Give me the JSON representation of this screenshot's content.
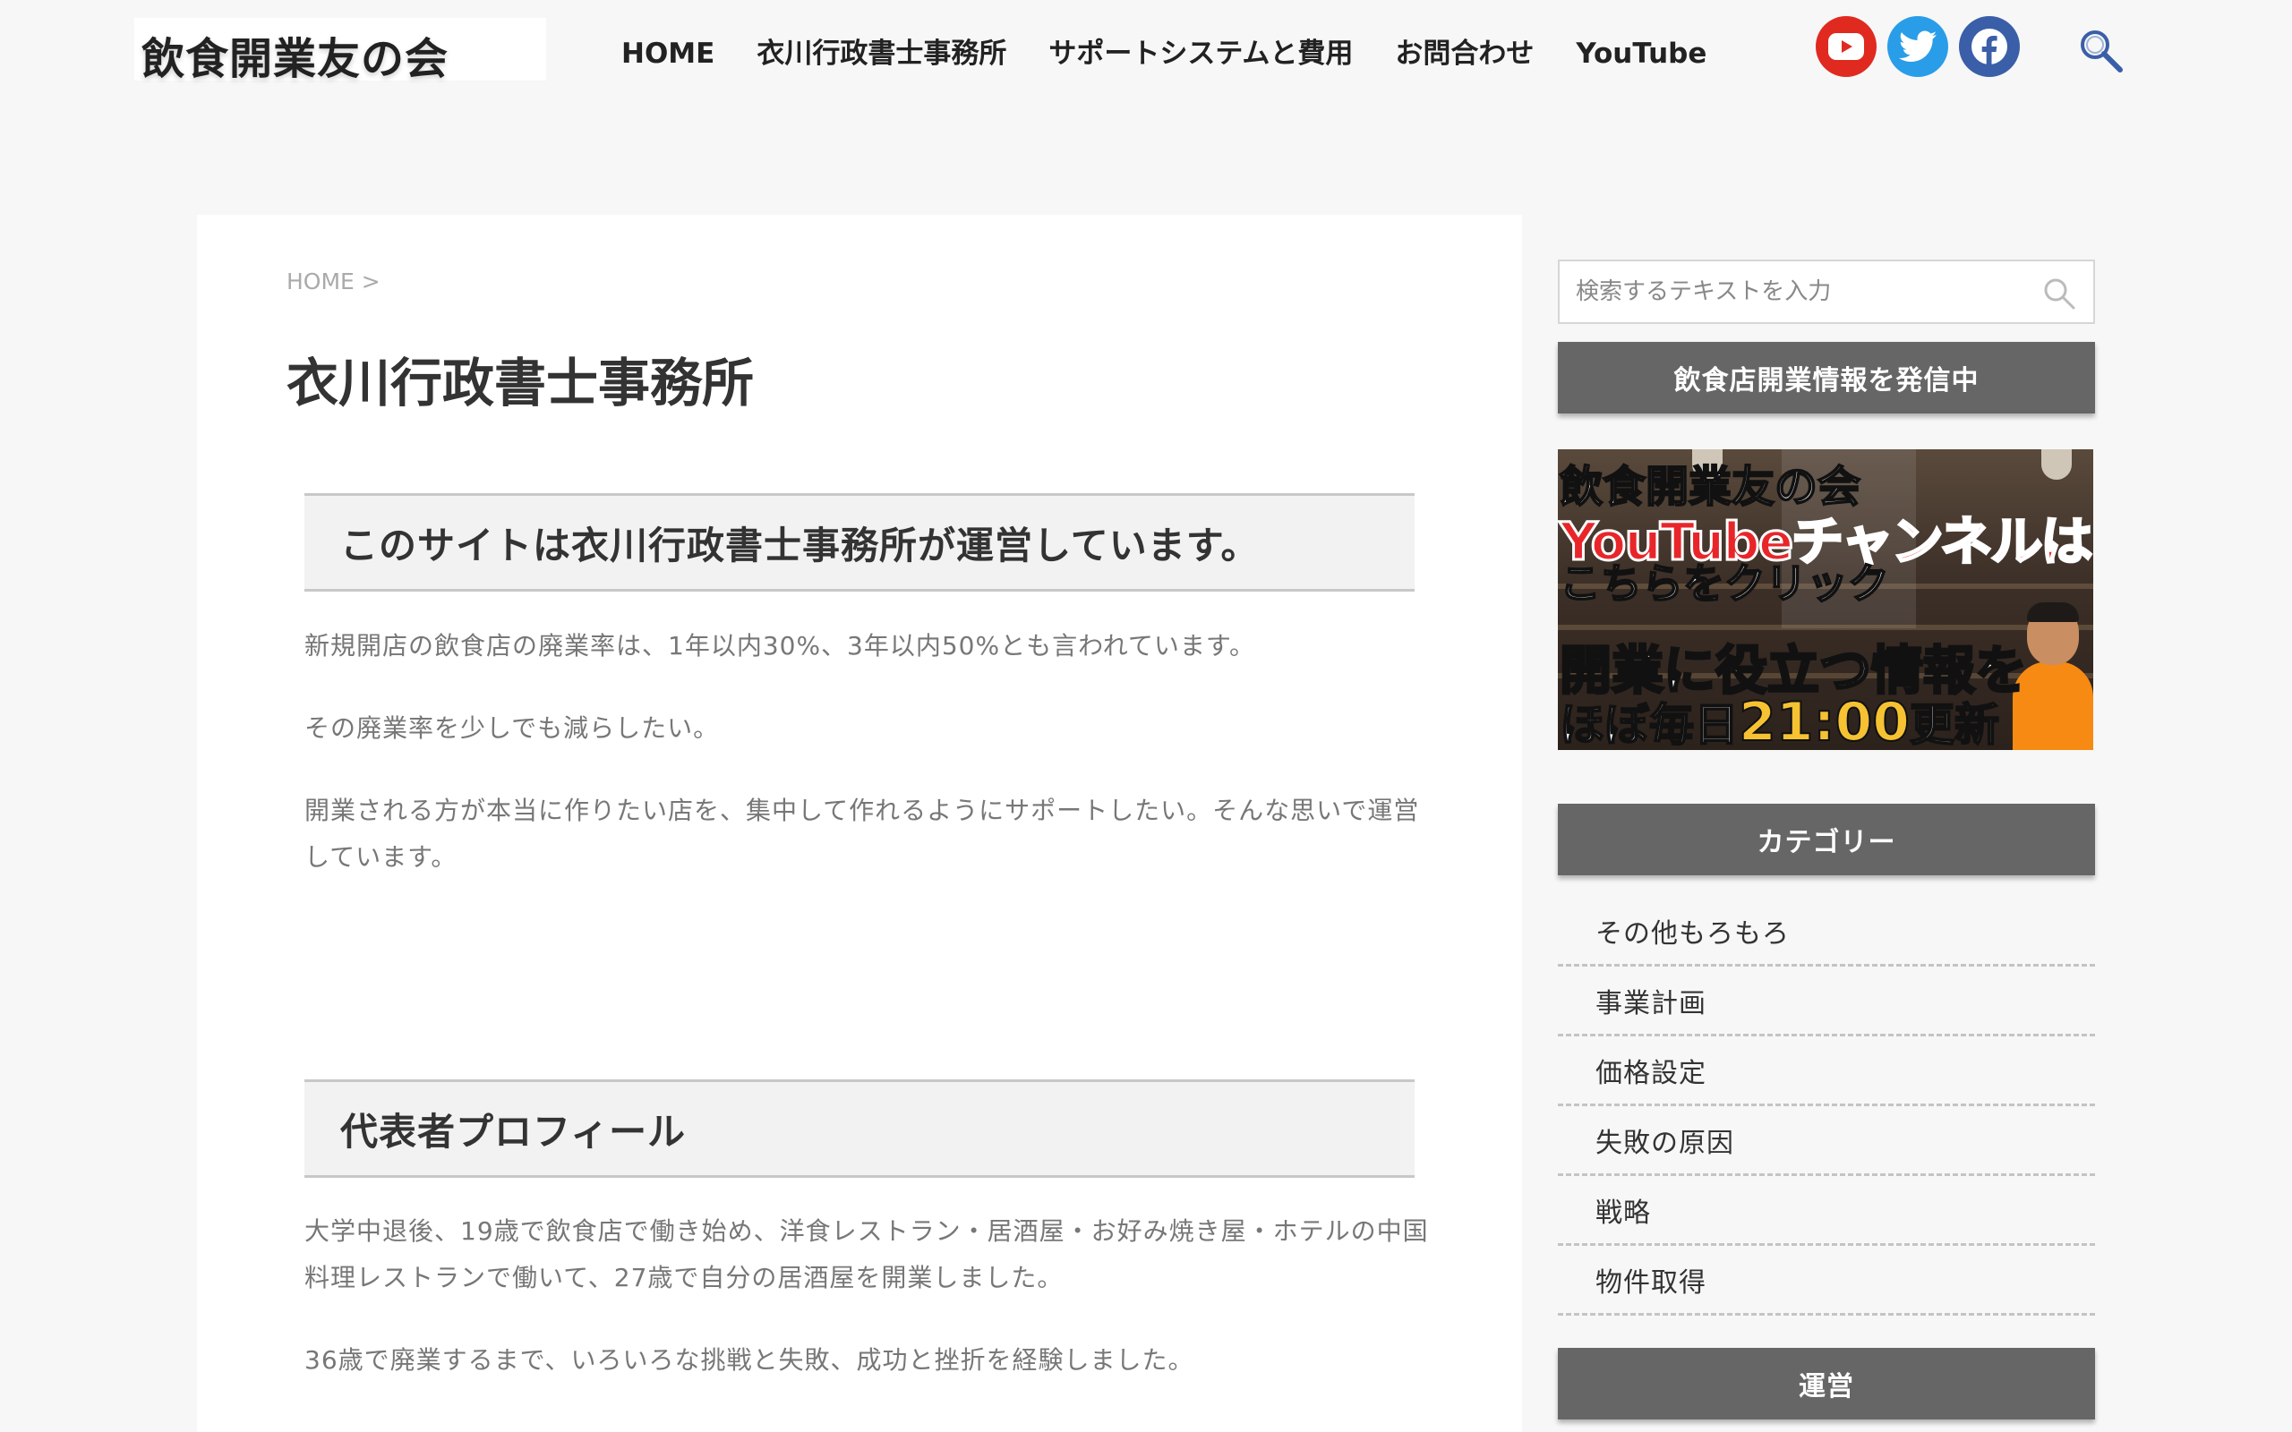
{
  "header": {
    "logo": "飲食開業友の会",
    "nav": [
      {
        "label": "HOME"
      },
      {
        "label": "衣川行政書士事務所"
      },
      {
        "label": "サポートシステムと費用"
      },
      {
        "label": "お問合わせ"
      },
      {
        "label": "YouTube"
      }
    ],
    "social": [
      {
        "icon": "youtube-icon",
        "color": "#e02a20"
      },
      {
        "icon": "twitter-icon",
        "color": "#2a9de8"
      },
      {
        "icon": "facebook-icon",
        "color": "#3a5fa8"
      }
    ],
    "search_icon": "search-icon"
  },
  "article": {
    "breadcrumb": "HOME >",
    "title": "衣川行政書士事務所",
    "sections": [
      {
        "heading": "このサイトは衣川行政書士事務所が運営しています。",
        "paragraphs": [
          "新規開店の飲食店の廃業率は、1年以内30%、3年以内50%とも言われています。",
          "その廃業率を少しでも減らしたい。",
          "開業される方が本当に作りたい店を、集中して作れるようにサポートしたい。そんな思いで運営しています。"
        ]
      },
      {
        "heading": "代表者プロフィール",
        "paragraphs": [
          "大学中退後、19歳で飲食店で働き始め、洋食レストラン・居酒屋・お好み焼き屋・ホテルの中国料理レストランで働いて、27歳で自分の居酒屋を開業しました。",
          "36歳で廃業するまで、いろいろな挑戦と失敗、成功と挫折を経験しました。"
        ]
      }
    ]
  },
  "sidebar": {
    "search_placeholder": "検索するテキストを入力",
    "widget1_title": "飲食店開業情報を発信中",
    "banner": {
      "line1": "飲食開業友の会",
      "line2": "YouTubeチャンネルは",
      "line3": "こちらをクリック",
      "line4": "開業に役立つ情報を",
      "line5_pre": "ほぼ毎日",
      "line5_num": "21:00",
      "line5_post": "更新"
    },
    "category_title": "カテゴリー",
    "categories": [
      {
        "label": "その他もろもろ"
      },
      {
        "label": "事業計画"
      },
      {
        "label": "価格設定"
      },
      {
        "label": "失敗の原因"
      },
      {
        "label": "戦略"
      },
      {
        "label": "物件取得"
      }
    ],
    "next_title": "運営"
  },
  "colors": {
    "background": "#f7f7f7",
    "card": "#ffffff",
    "widget_heading": "#666666",
    "section_heading_bg": "#f2f2f2",
    "body_text": "#777777",
    "banner_red": "#e8262a",
    "banner_yellow": "#f6c232"
  }
}
